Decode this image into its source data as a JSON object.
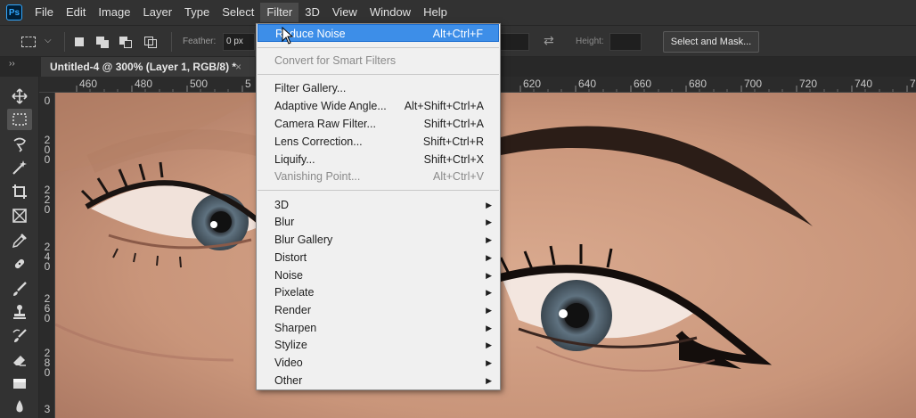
{
  "app": {
    "logo": "Ps",
    "menubar": [
      "File",
      "Edit",
      "Image",
      "Layer",
      "Type",
      "Select",
      "Filter",
      "3D",
      "View",
      "Window",
      "Help"
    ],
    "active_menu": "Filter"
  },
  "options": {
    "feather_label": "Feather:",
    "feather_value": "0 px",
    "height_label": "Height:",
    "select_and_mask": "Select and Mask...",
    "collapse_icon": "››",
    "swap_icon": "⇄"
  },
  "document": {
    "tab_title": "Untitled-4 @ 300% (Layer 1, RGB/8) *",
    "close": "×"
  },
  "ruler": {
    "top_labels": [
      "460",
      "480",
      "500",
      "5",
      "620",
      "640",
      "660",
      "680",
      "700",
      "720",
      "740",
      "7"
    ],
    "left_groups": [
      [
        "0"
      ],
      [
        "2",
        "0",
        "0"
      ],
      [
        "2",
        "2",
        "0"
      ],
      [
        "2",
        "4",
        "0"
      ],
      [
        "2",
        "6",
        "0"
      ],
      [
        "2",
        "8",
        "0"
      ],
      [
        "3"
      ]
    ]
  },
  "filter_menu": {
    "items": [
      {
        "label": "Reduce Noise",
        "shortcut": "Alt+Ctrl+F",
        "highlight": true
      },
      {
        "separator": true
      },
      {
        "label": "Convert for Smart Filters",
        "disabled": true
      },
      {
        "separator": true
      },
      {
        "label": "Filter Gallery..."
      },
      {
        "label": "Adaptive Wide Angle...",
        "shortcut": "Alt+Shift+Ctrl+A"
      },
      {
        "label": "Camera Raw Filter...",
        "shortcut": "Shift+Ctrl+A"
      },
      {
        "label": "Lens Correction...",
        "shortcut": "Shift+Ctrl+R"
      },
      {
        "label": "Liquify...",
        "shortcut": "Shift+Ctrl+X"
      },
      {
        "label": "Vanishing Point...",
        "shortcut": "Alt+Ctrl+V",
        "disabled": true
      },
      {
        "separator": true
      },
      {
        "label": "3D",
        "submenu": true
      },
      {
        "label": "Blur",
        "submenu": true
      },
      {
        "label": "Blur Gallery",
        "submenu": true
      },
      {
        "label": "Distort",
        "submenu": true
      },
      {
        "label": "Noise",
        "submenu": true
      },
      {
        "label": "Pixelate",
        "submenu": true
      },
      {
        "label": "Render",
        "submenu": true
      },
      {
        "label": "Sharpen",
        "submenu": true
      },
      {
        "label": "Stylize",
        "submenu": true
      },
      {
        "label": "Video",
        "submenu": true
      },
      {
        "label": "Other",
        "submenu": true
      }
    ],
    "submenu_arrow": "▶"
  },
  "tools": [
    "move-icon",
    "marquee-icon",
    "lasso-icon",
    "magic-wand-icon",
    "crop-icon",
    "frame-icon",
    "eyedropper-icon",
    "healing-brush-icon",
    "brush-icon",
    "clone-stamp-icon",
    "history-brush-icon",
    "eraser-icon",
    "gradient-icon",
    "blur-icon"
  ],
  "colors": {
    "highlight": "#3d8ee8",
    "menu_bg": "#f0f0f0",
    "ui_bg": "#323232"
  }
}
